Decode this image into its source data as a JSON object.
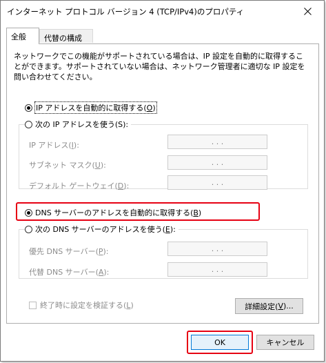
{
  "window": {
    "title": "インターネット プロトコル バージョン 4 (TCP/IPv4)のプロパティ"
  },
  "tabs": [
    {
      "label": "全般"
    },
    {
      "label": "代替の構成"
    }
  ],
  "description": "ネットワークでこの機能がサポートされている場合は、IP 設定を自動的に取得することができます。サポートされていない場合は、ネットワーク管理者に適切な IP 設定を問い合わせてください。",
  "ip": {
    "auto_label": "IP アドレスを自動的に取得する(",
    "auto_key": "O",
    "auto_tail": ")",
    "auto_selected": true,
    "manual_label": "次の IP アドレスを使う(S):",
    "fields": [
      {
        "label": "IP アドレス(",
        "key": "I",
        "tail": "):",
        "value": ". . ."
      },
      {
        "label": "サブネット マスク(",
        "key": "U",
        "tail": "):",
        "value": ". . ."
      },
      {
        "label": "デフォルト ゲートウェイ(",
        "key": "D",
        "tail": "):",
        "value": ". . ."
      }
    ]
  },
  "dns": {
    "auto_label": "DNS サーバーのアドレスを自動的に取得する(",
    "auto_key": "B",
    "auto_tail": ")",
    "auto_selected": true,
    "manual_label": "次の DNS サーバーのアドレスを使う(",
    "manual_key": "E",
    "manual_tail": "):",
    "fields": [
      {
        "label": "優先 DNS サーバー(",
        "key": "P",
        "tail": "):",
        "value": ". . ."
      },
      {
        "label": "代替 DNS サーバー(",
        "key": "A",
        "tail": "):",
        "value": ". . ."
      }
    ]
  },
  "validate": {
    "label": "終了時に設定を検証する(",
    "key": "L",
    "tail": ")",
    "checked": false
  },
  "buttons": {
    "advanced_prefix": "詳細設定(",
    "advanced_key": "V",
    "advanced_tail": ")...",
    "ok": "OK",
    "cancel": "キャンセル"
  },
  "colors": {
    "highlight": "#e60012",
    "default_button": "#0078d7"
  }
}
